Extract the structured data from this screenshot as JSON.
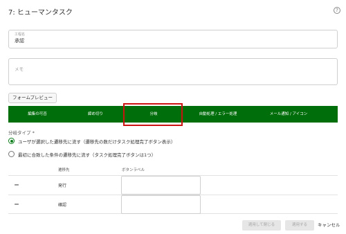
{
  "dialog": {
    "title": "7: ヒューマンタスク",
    "help_icon": "question-circle-icon"
  },
  "fields": {
    "step_name": {
      "label": "工程名",
      "value": "承認"
    },
    "memo": {
      "label": "メモ"
    }
  },
  "form_preview_label": "フォームプレビュー",
  "tabs": [
    {
      "label": "編集の可否"
    },
    {
      "label": "締め切り"
    },
    {
      "label": "分岐"
    },
    {
      "label": "自動処理 / エラー処理"
    },
    {
      "label": "メール通知 / アイコン"
    }
  ],
  "active_tab_index": 2,
  "colors": {
    "tab_bar": "#006e0b",
    "active_highlight": "#cc1111",
    "radio_selected": "#0a7d1a"
  },
  "branch": {
    "type_label": "分岐タイプ *",
    "options": [
      {
        "label": "ユーザが選択した遷移先に流す（遷移先の数だけタスク処理完了ボタン表示）",
        "selected": true
      },
      {
        "label": "最初に合致した条件の遷移先に流す（タスク処理完了ボタンは1つ）",
        "selected": false
      }
    ]
  },
  "table": {
    "headers": {
      "destination": "遷移先",
      "button_label": "ボタンラベル"
    },
    "rows": [
      {
        "handle": "＝",
        "destination": "発行",
        "button_label": ""
      },
      {
        "handle": "＝",
        "destination": "確認",
        "button_label": ""
      }
    ]
  },
  "footer": {
    "apply_close": "適用して閉じる",
    "apply": "適用する",
    "cancel": "キャンセル"
  }
}
